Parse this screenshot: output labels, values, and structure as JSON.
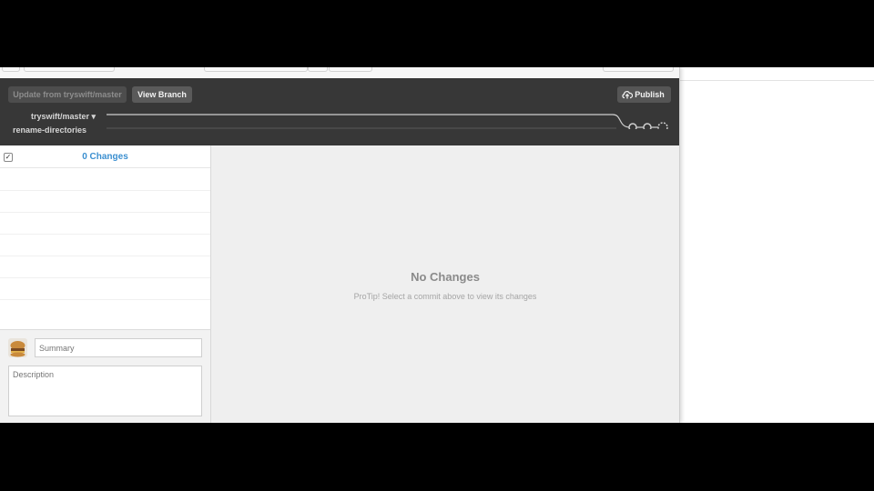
{
  "toolbar": {
    "update_label": "Update from tryswift/master",
    "view_branch_label": "View Branch",
    "publish_label": "Publish",
    "publish_icon": "cloud-upload-icon"
  },
  "branches": {
    "base": "tryswift/master ▾",
    "current": "rename-directories"
  },
  "changes": {
    "title": "0 Changes",
    "checkbox_mark": "✓"
  },
  "commit": {
    "summary_placeholder": "Summary",
    "description_placeholder": "Description"
  },
  "diff": {
    "title": "No Changes",
    "tip": "ProTip! Select a commit above to view its changes"
  },
  "colors": {
    "accent": "#3b8fd0",
    "toolbar_bg": "#373737"
  }
}
